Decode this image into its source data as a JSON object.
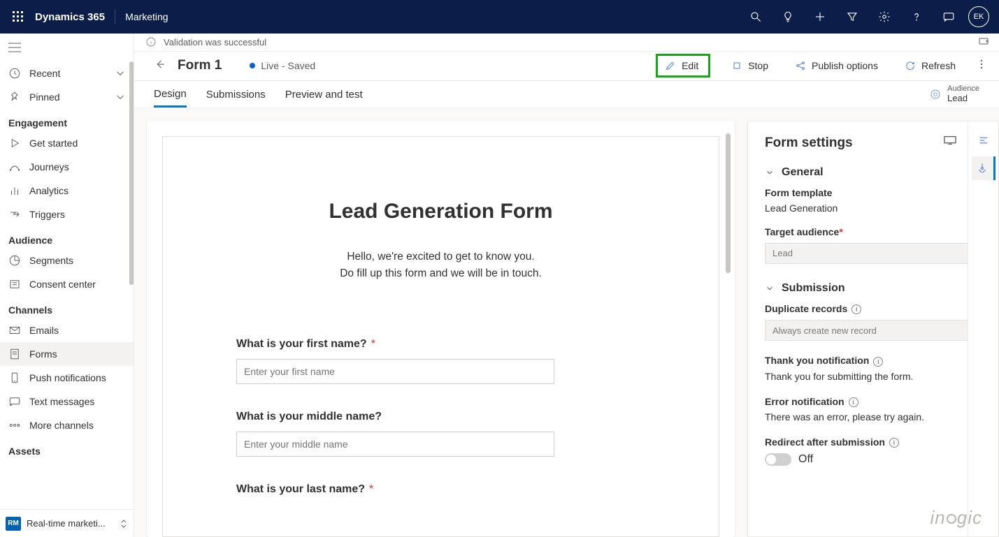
{
  "topbar": {
    "brand": "Dynamics 365",
    "area": "Marketing",
    "avatar": "EK"
  },
  "notification": "Validation was successful",
  "nav": {
    "recent": "Recent",
    "pinned": "Pinned",
    "groups": {
      "engagement": "Engagement",
      "audience": "Audience",
      "channels": "Channels",
      "assets": "Assets"
    },
    "items": {
      "getstarted": "Get started",
      "journeys": "Journeys",
      "analytics": "Analytics",
      "triggers": "Triggers",
      "segments": "Segments",
      "consent": "Consent center",
      "emails": "Emails",
      "forms": "Forms",
      "push": "Push notifications",
      "text": "Text messages",
      "more": "More channels"
    },
    "areaswitch": {
      "badge": "RM",
      "label": "Real-time marketi..."
    }
  },
  "record": {
    "title": "Form 1",
    "status": "Live - Saved"
  },
  "commands": {
    "edit": "Edit",
    "stop": "Stop",
    "publish": "Publish options",
    "refresh": "Refresh"
  },
  "tabs": {
    "design": "Design",
    "submissions": "Submissions",
    "preview": "Preview and test"
  },
  "audiencePill": {
    "label": "Audience",
    "value": "Lead"
  },
  "canvas": {
    "title": "Lead Generation Form",
    "intro1": "Hello, we're excited to get to know you.",
    "intro2": "Do fill up this form and we will be in touch.",
    "f1_label": "What is your first name?",
    "f1_ph": "Enter your first name",
    "f2_label": "What is your middle name?",
    "f2_ph": "Enter your middle name",
    "f3_label": "What is your last name?"
  },
  "settings": {
    "title": "Form settings",
    "general": "General",
    "formtpl_label": "Form template",
    "formtpl_value": "Lead Generation",
    "target_label": "Target audience",
    "target_value": "Lead",
    "submission": "Submission",
    "dup_label": "Duplicate records",
    "dup_value": "Always create new record",
    "thanks_label": "Thank you notification",
    "thanks_value": "Thank you for submitting the form.",
    "error_label": "Error notification",
    "error_value": "There was an error, please try again.",
    "redirect_label": "Redirect after submission",
    "redirect_state": "Off"
  },
  "watermark": "inogic"
}
